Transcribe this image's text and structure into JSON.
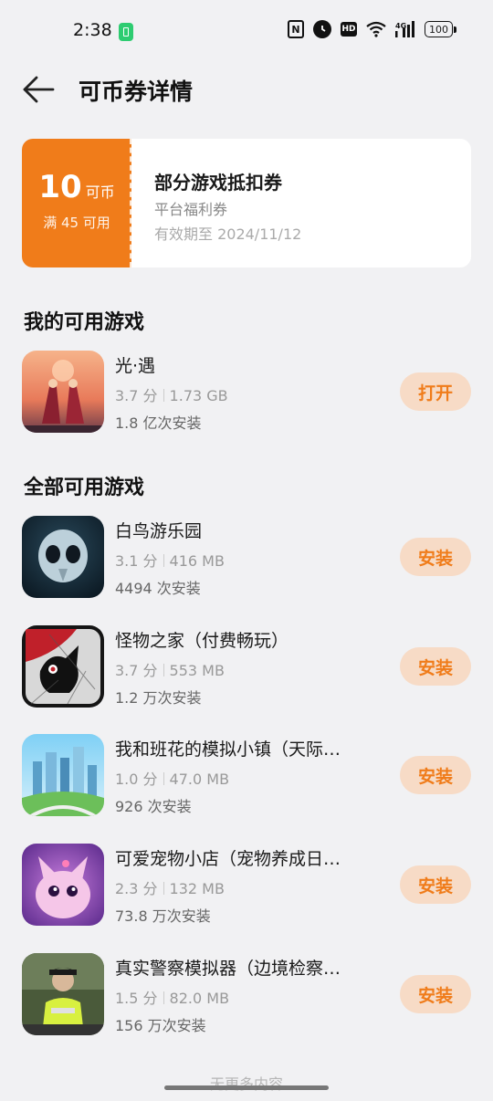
{
  "status_bar": {
    "time": "2:38",
    "battery": "100",
    "icons": [
      "battery-saver-icon",
      "nfc-icon",
      "alarm-icon",
      "hd-icon",
      "wifi-icon",
      "signal-4g-icon",
      "battery-icon"
    ],
    "network": "4G"
  },
  "header": {
    "title": "可币券详情",
    "back_icon": "back-arrow-icon"
  },
  "coupon": {
    "amount": "10",
    "unit": "可币",
    "condition": "满 45 可用",
    "title": "部分游戏抵扣券",
    "type": "平台福利券",
    "validity": "有效期至 2024/11/12",
    "accent_color": "#f07c1a"
  },
  "my_games": {
    "title": "我的可用游戏",
    "items": [
      {
        "name": "光·遇",
        "rating": "3.7 分",
        "size": "1.73 GB",
        "installs": "1.8 亿次安装",
        "action": "打开"
      }
    ]
  },
  "all_games": {
    "title": "全部可用游戏",
    "items": [
      {
        "name": "白鸟游乐园",
        "rating": "3.1 分",
        "size": "416 MB",
        "installs": "4494 次安装",
        "action": "安装"
      },
      {
        "name": "怪物之家（付费畅玩）",
        "rating": "3.7 分",
        "size": "553 MB",
        "installs": "1.2 万次安装",
        "action": "安装"
      },
      {
        "name": "我和班花的模拟小镇（天际…",
        "rating": "1.0 分",
        "size": "47.0 MB",
        "installs": "926 次安装",
        "action": "安装"
      },
      {
        "name": "可爱宠物小店（宠物养成日…",
        "rating": "2.3 分",
        "size": "132 MB",
        "installs": "73.8 万次安装",
        "action": "安装"
      },
      {
        "name": "真实警察模拟器（边境检察…",
        "rating": "1.5 分",
        "size": "82.0 MB",
        "installs": "156 万次安装",
        "action": "安装"
      }
    ]
  },
  "footer": {
    "text": "无更多内容"
  },
  "colors": {
    "accent": "#f07c1a",
    "button_bg": "#f7dbc6",
    "page_bg": "#f1f1f3"
  }
}
